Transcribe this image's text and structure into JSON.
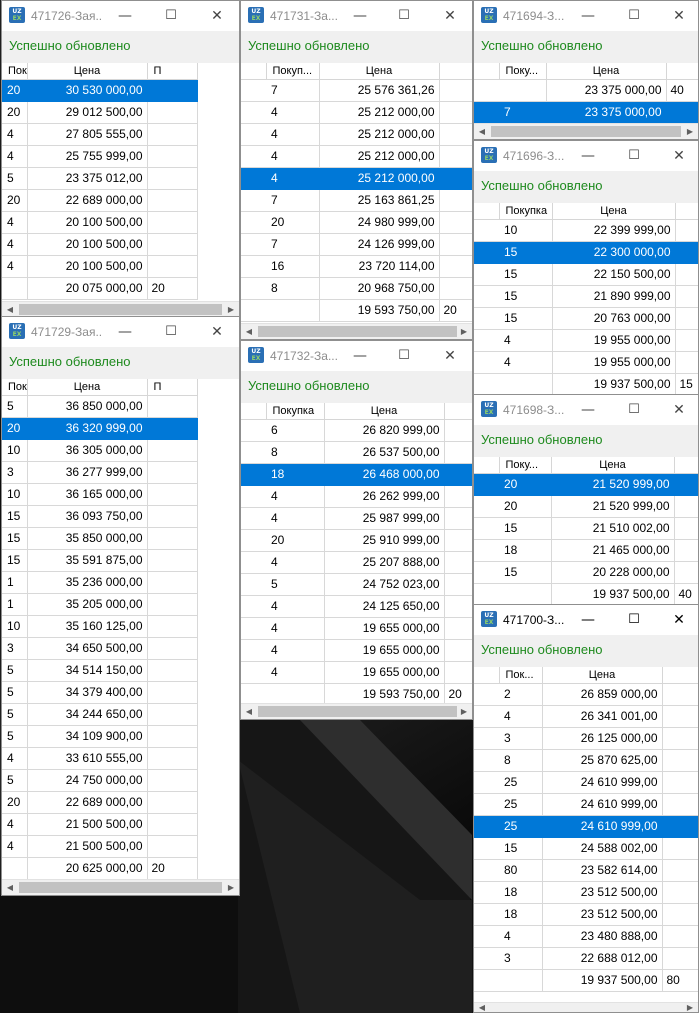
{
  "status_message": "Успешно обновлено",
  "selection_color": "#0078d7",
  "status_color": "#1e8a1e",
  "windows": [
    {
      "id": "w726",
      "title": "471726-Зая...",
      "active": false,
      "col_qty": "Поку...",
      "col_price": "Цена",
      "col_extra": "П",
      "rows": [
        {
          "qty": "20",
          "price": "30 530 000,00",
          "extra": "",
          "selected": true
        },
        {
          "qty": "20",
          "price": "29 012 500,00",
          "extra": ""
        },
        {
          "qty": "4",
          "price": "27 805 555,00",
          "extra": ""
        },
        {
          "qty": "4",
          "price": "25 755 999,00",
          "extra": ""
        },
        {
          "qty": "5",
          "price": "23 375 012,00",
          "extra": ""
        },
        {
          "qty": "20",
          "price": "22 689 000,00",
          "extra": ""
        },
        {
          "qty": "4",
          "price": "20 100 500,00",
          "extra": ""
        },
        {
          "qty": "4",
          "price": "20 100 500,00",
          "extra": ""
        },
        {
          "qty": "4",
          "price": "20 100 500,00",
          "extra": ""
        },
        {
          "qty": "",
          "price": "20 075 000,00",
          "extra": "20"
        }
      ]
    },
    {
      "id": "w731",
      "title": "471731-За...",
      "active": false,
      "col_qty": "Покуп...",
      "col_price": "Цена",
      "col_extra": "",
      "rows": [
        {
          "qty": "7",
          "price": "25 576 361,26",
          "extra": ""
        },
        {
          "qty": "4",
          "price": "25 212 000,00",
          "extra": ""
        },
        {
          "qty": "4",
          "price": "25 212 000,00",
          "extra": ""
        },
        {
          "qty": "4",
          "price": "25 212 000,00",
          "extra": ""
        },
        {
          "qty": "4",
          "price": "25 212 000,00",
          "extra": "",
          "selected": true
        },
        {
          "qty": "7",
          "price": "25 163 861,25",
          "extra": ""
        },
        {
          "qty": "20",
          "price": "24 980 999,00",
          "extra": ""
        },
        {
          "qty": "7",
          "price": "24 126 999,00",
          "extra": ""
        },
        {
          "qty": "16",
          "price": "23 720 114,00",
          "extra": ""
        },
        {
          "qty": "8",
          "price": "20 968 750,00",
          "extra": ""
        },
        {
          "qty": "",
          "price": "19 593 750,00",
          "extra": "20"
        }
      ]
    },
    {
      "id": "w694",
      "title": "471694-З...",
      "active": false,
      "col_qty": "Поку...",
      "col_price": "Цена",
      "col_extra": "",
      "rows": [
        {
          "qty": "",
          "price": "23 375 000,00",
          "extra": "40"
        },
        {
          "qty": "7",
          "price": "23 375 000,00",
          "extra": "",
          "selected": true
        }
      ]
    },
    {
      "id": "w696",
      "title": "471696-З...",
      "active": false,
      "col_qty": "Покупка",
      "col_price": "Цена",
      "col_extra": "",
      "rows": [
        {
          "qty": "10",
          "price": "22 399 999,00",
          "extra": ""
        },
        {
          "qty": "15",
          "price": "22 300 000,00",
          "extra": "",
          "selected": true
        },
        {
          "qty": "15",
          "price": "22 150 500,00",
          "extra": ""
        },
        {
          "qty": "15",
          "price": "21 890 999,00",
          "extra": ""
        },
        {
          "qty": "15",
          "price": "20 763 000,00",
          "extra": ""
        },
        {
          "qty": "4",
          "price": "19 955 000,00",
          "extra": ""
        },
        {
          "qty": "4",
          "price": "19 955 000,00",
          "extra": ""
        },
        {
          "qty": "",
          "price": "19 937 500,00",
          "extra": "15"
        }
      ]
    },
    {
      "id": "w729",
      "title": "471729-Зая...",
      "active": false,
      "col_qty": "Поку...",
      "col_price": "Цена",
      "col_extra": "П",
      "rows": [
        {
          "qty": "5",
          "price": "36 850 000,00",
          "extra": ""
        },
        {
          "qty": "20",
          "price": "36 320 999,00",
          "extra": "",
          "selected": true
        },
        {
          "qty": "10",
          "price": "36 305 000,00",
          "extra": ""
        },
        {
          "qty": "3",
          "price": "36 277 999,00",
          "extra": ""
        },
        {
          "qty": "10",
          "price": "36 165 000,00",
          "extra": ""
        },
        {
          "qty": "15",
          "price": "36 093 750,00",
          "extra": ""
        },
        {
          "qty": "15",
          "price": "35 850 000,00",
          "extra": ""
        },
        {
          "qty": "15",
          "price": "35 591 875,00",
          "extra": ""
        },
        {
          "qty": "1",
          "price": "35 236 000,00",
          "extra": ""
        },
        {
          "qty": "1",
          "price": "35 205 000,00",
          "extra": ""
        },
        {
          "qty": "10",
          "price": "35 160 125,00",
          "extra": ""
        },
        {
          "qty": "3",
          "price": "34 650 500,00",
          "extra": ""
        },
        {
          "qty": "5",
          "price": "34 514 150,00",
          "extra": ""
        },
        {
          "qty": "5",
          "price": "34 379 400,00",
          "extra": ""
        },
        {
          "qty": "5",
          "price": "34 244 650,00",
          "extra": ""
        },
        {
          "qty": "5",
          "price": "34 109 900,00",
          "extra": ""
        },
        {
          "qty": "4",
          "price": "33 610 555,00",
          "extra": ""
        },
        {
          "qty": "5",
          "price": "24 750 000,00",
          "extra": ""
        },
        {
          "qty": "20",
          "price": "22 689 000,00",
          "extra": ""
        },
        {
          "qty": "4",
          "price": "21 500 500,00",
          "extra": ""
        },
        {
          "qty": "4",
          "price": "21 500 500,00",
          "extra": ""
        },
        {
          "qty": "",
          "price": "20 625 000,00",
          "extra": "20"
        }
      ]
    },
    {
      "id": "w732",
      "title": "471732-За...",
      "active": false,
      "col_qty": "Покупка",
      "col_price": "Цена",
      "col_extra": "",
      "rows": [
        {
          "qty": "6",
          "price": "26 820 999,00",
          "extra": ""
        },
        {
          "qty": "8",
          "price": "26 537 500,00",
          "extra": ""
        },
        {
          "qty": "18",
          "price": "26 468 000,00",
          "extra": "",
          "selected": true
        },
        {
          "qty": "4",
          "price": "26 262 999,00",
          "extra": ""
        },
        {
          "qty": "4",
          "price": "25 987 999,00",
          "extra": ""
        },
        {
          "qty": "20",
          "price": "25 910 999,00",
          "extra": ""
        },
        {
          "qty": "4",
          "price": "25 207 888,00",
          "extra": ""
        },
        {
          "qty": "5",
          "price": "24 752 023,00",
          "extra": ""
        },
        {
          "qty": "4",
          "price": "24 125 650,00",
          "extra": ""
        },
        {
          "qty": "4",
          "price": "19 655 000,00",
          "extra": ""
        },
        {
          "qty": "4",
          "price": "19 655 000,00",
          "extra": ""
        },
        {
          "qty": "4",
          "price": "19 655 000,00",
          "extra": ""
        },
        {
          "qty": "",
          "price": "19 593 750,00",
          "extra": "20"
        }
      ]
    },
    {
      "id": "w698",
      "title": "471698-З...",
      "active": false,
      "col_qty": "Поку...",
      "col_price": "Цена",
      "col_extra": "",
      "rows": [
        {
          "qty": "20",
          "price": "21 520 999,00",
          "extra": "",
          "selected": true
        },
        {
          "qty": "20",
          "price": "21 520 999,00",
          "extra": ""
        },
        {
          "qty": "15",
          "price": "21 510 002,00",
          "extra": ""
        },
        {
          "qty": "18",
          "price": "21 465 000,00",
          "extra": ""
        },
        {
          "qty": "15",
          "price": "20 228 000,00",
          "extra": ""
        },
        {
          "qty": "",
          "price": "19 937 500,00",
          "extra": "40"
        }
      ]
    },
    {
      "id": "w700",
      "title": "471700-З...",
      "active": true,
      "col_qty": "Пок...",
      "col_price": "Цена",
      "col_extra": "",
      "rows": [
        {
          "qty": "2",
          "price": "26 859 000,00",
          "extra": ""
        },
        {
          "qty": "4",
          "price": "26 341 001,00",
          "extra": ""
        },
        {
          "qty": "3",
          "price": "26 125 000,00",
          "extra": ""
        },
        {
          "qty": "8",
          "price": "25 870 625,00",
          "extra": ""
        },
        {
          "qty": "25",
          "price": "24 610 999,00",
          "extra": ""
        },
        {
          "qty": "25",
          "price": "24 610 999,00",
          "extra": ""
        },
        {
          "qty": "25",
          "price": "24 610 999,00",
          "extra": "",
          "selected": true
        },
        {
          "qty": "15",
          "price": "24 588 002,00",
          "extra": ""
        },
        {
          "qty": "80",
          "price": "23 582 614,00",
          "extra": ""
        },
        {
          "qty": "18",
          "price": "23 512 500,00",
          "extra": ""
        },
        {
          "qty": "18",
          "price": "23 512 500,00",
          "extra": ""
        },
        {
          "qty": "4",
          "price": "23 480 888,00",
          "extra": ""
        },
        {
          "qty": "3",
          "price": "22 688 012,00",
          "extra": ""
        },
        {
          "qty": "",
          "price": "19 937 500,00",
          "extra": "80"
        }
      ]
    }
  ]
}
